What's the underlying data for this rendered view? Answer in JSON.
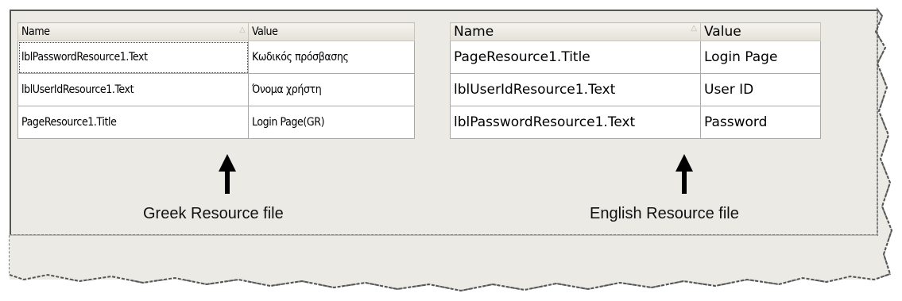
{
  "greek_table": {
    "columns": [
      "Name",
      "Value"
    ],
    "rows": [
      {
        "name": "lblPasswordResource1.Text",
        "value": "Κωδικός πρόσβασης"
      },
      {
        "name": "lblUserIdResource1.Text",
        "value": "Όνομα χρήστη"
      },
      {
        "name": "PageResource1.Title",
        "value": "Login Page(GR)"
      }
    ],
    "caption": "Greek Resource file"
  },
  "english_table": {
    "columns": [
      "Name",
      "Value"
    ],
    "rows": [
      {
        "name": "PageResource1.Title",
        "value": "Login Page"
      },
      {
        "name": "lblUserIdResource1.Text",
        "value": "User ID"
      },
      {
        "name": "lblPasswordResource1.Text",
        "value": "Password"
      }
    ],
    "caption": "English Resource file"
  },
  "icons": {
    "sort": "sort-ascending-icon",
    "arrow": "up-arrow-icon"
  },
  "colors": {
    "panel": "#ebeae5",
    "grid_border": "#a9a9a9",
    "header": "#e3e1d8"
  }
}
